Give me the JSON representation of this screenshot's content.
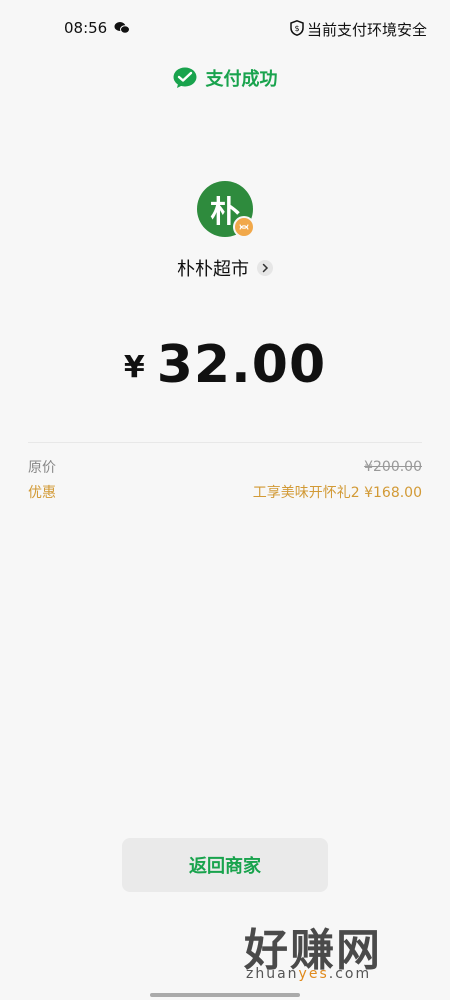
{
  "status_bar": {
    "time": "08:56",
    "security_text": "当前支付环境安全"
  },
  "success": {
    "text": "支付成功",
    "color": "#19a34d"
  },
  "merchant": {
    "logo_char": "朴",
    "logo_color": "#2e8b3d",
    "name": "朴朴超市"
  },
  "amount": {
    "currency": "¥",
    "value": "32.00"
  },
  "details": {
    "original_label": "原价",
    "original_value": "¥200.00",
    "discount_label": "优惠",
    "discount_value": "工享美味开怀礼2 ¥168.00",
    "discount_color": "#d29a36"
  },
  "actions": {
    "return_label": "返回商家"
  },
  "watermark": {
    "title": "好赚网",
    "url_part1": "zhuan",
    "url_part2": "yes",
    "url_part3": ".com"
  }
}
